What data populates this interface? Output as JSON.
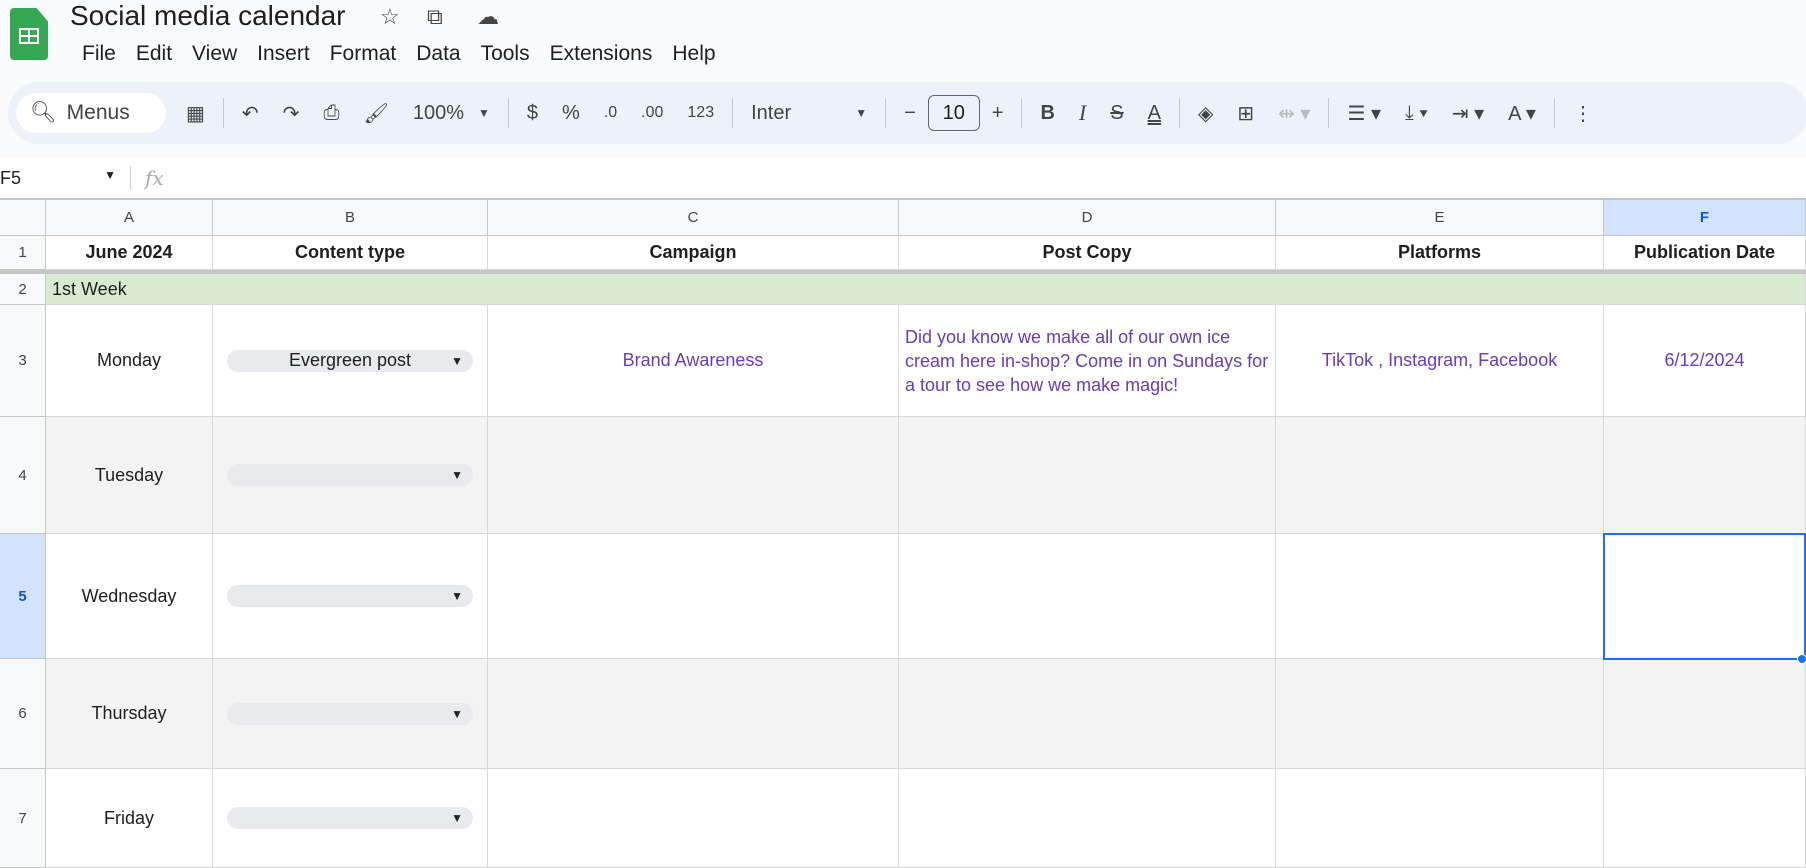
{
  "doc": {
    "title": "Social media calendar"
  },
  "menu": [
    "File",
    "Edit",
    "View",
    "Insert",
    "Format",
    "Data",
    "Tools",
    "Extensions",
    "Help"
  ],
  "toolbar": {
    "search": "Menus",
    "zoom": "100%",
    "currency": "$",
    "percent": "%",
    "dec_decrease": ".0",
    "dec_increase": ".00",
    "number_format": "123",
    "font": "Inter",
    "font_size": "10",
    "minus": "−",
    "plus": "+",
    "bold": "B",
    "italic": "I",
    "text_color": "A"
  },
  "formula_bar": {
    "name_box": "F5",
    "fx": "fx",
    "value": ""
  },
  "columns": [
    "A",
    "B",
    "C",
    "D",
    "E",
    "F"
  ],
  "rows": [
    "1",
    "2",
    "3",
    "4",
    "5",
    "6",
    "7"
  ],
  "header_row": [
    "June 2024",
    "Content type",
    "Campaign",
    "Post Copy",
    "Platforms",
    "Publication Date"
  ],
  "week_label": "1st Week",
  "days": [
    "Monday",
    "Tuesday",
    "Wednesday",
    "Thursday",
    "Friday"
  ],
  "row3": {
    "content_type": "Evergreen post",
    "campaign": "Brand Awareness",
    "post_copy": "Did you know we make all of our own ice cream here in-shop? Come in on Sundays for a tour to see how we make magic!",
    "platforms": "TikTok , Instagram, Facebook",
    "date": "6/12/2024"
  },
  "colors": {
    "accent": "#1a73e8",
    "week_band": "#d9ead3",
    "text_purple": "#6a3bbf"
  }
}
